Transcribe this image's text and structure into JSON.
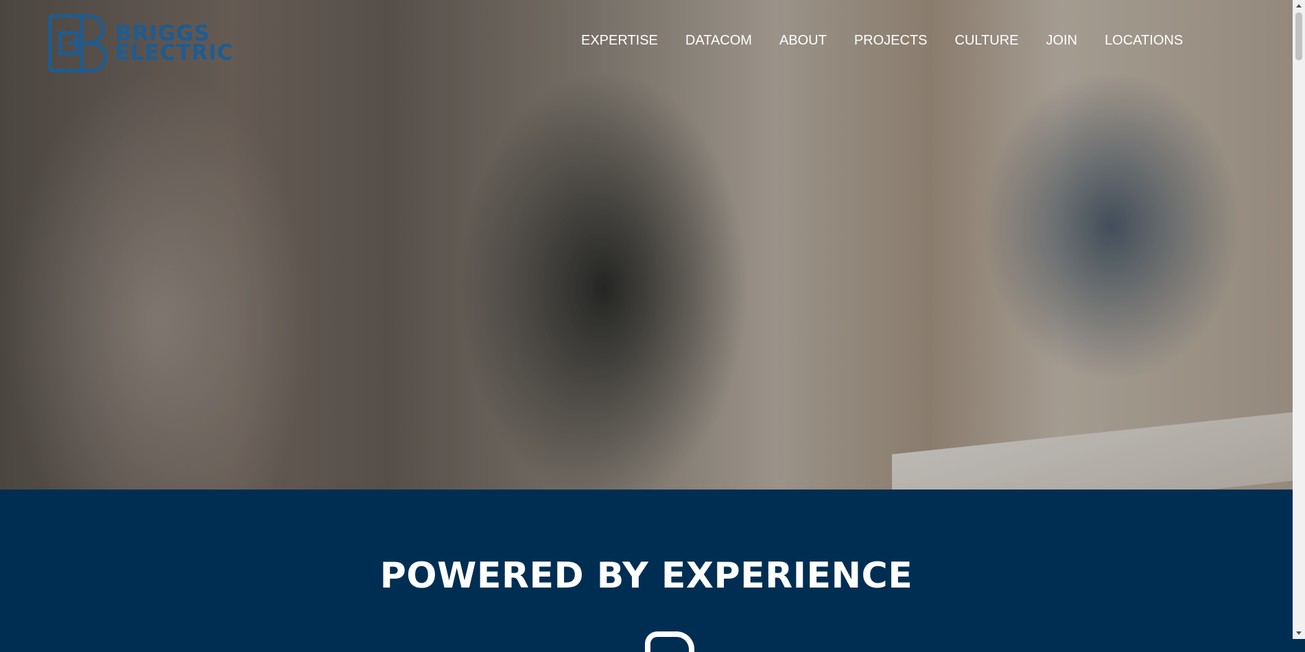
{
  "brand": {
    "line1": "BRIGGS",
    "line2": "ELECTRIC",
    "color": "#1d5c93"
  },
  "nav": [
    {
      "label": "EXPERTISE"
    },
    {
      "label": "DATACOM"
    },
    {
      "label": "ABOUT"
    },
    {
      "label": "PROJECTS"
    },
    {
      "label": "CULTURE"
    },
    {
      "label": "JOIN"
    },
    {
      "label": "LOCATIONS"
    }
  ],
  "section": {
    "title": "POWERED BY EXPERIENCE",
    "background": "#002e52"
  }
}
